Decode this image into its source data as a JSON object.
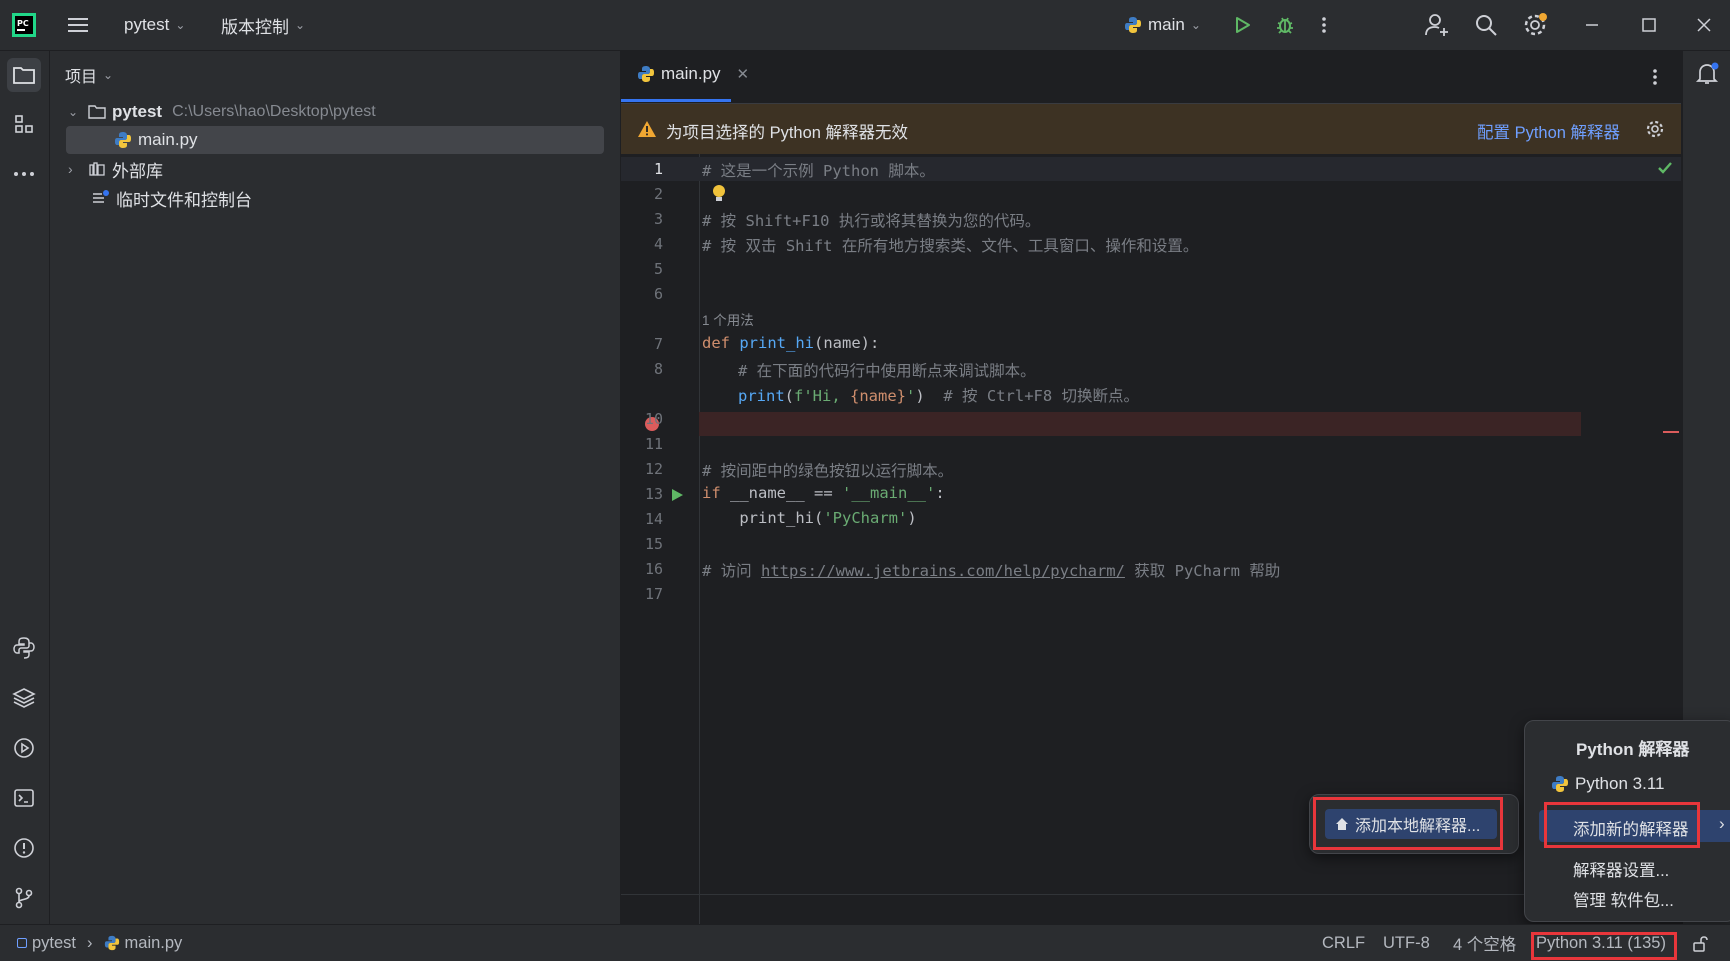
{
  "titlebar": {
    "project_name": "pytest",
    "vcs_label": "版本控制",
    "run_config": "main",
    "icons": [
      "pycharm-logo",
      "hamburger-menu-icon",
      "run-icon",
      "debug-icon",
      "more-vertical-icon",
      "add-user-icon",
      "search-icon",
      "settings-icon",
      "minimize-icon",
      "maximize-icon",
      "close-icon"
    ]
  },
  "project_panel": {
    "header": "项目",
    "tree": {
      "root_name": "pytest",
      "root_path": "C:\\Users\\hao\\Desktop\\pytest",
      "file": "main.py",
      "external_libs": "外部库",
      "scratches": "临时文件和控制台"
    }
  },
  "editor": {
    "tab_label": "main.py",
    "banner_text": "为项目选择的 Python 解释器无效",
    "banner_link": "配置 Python 解释器",
    "usage_hint": "1 个用法",
    "lines": {
      "l1": "# 这是一个示例 Python 脚本。",
      "l3": "# 按 Shift+F10 执行或将其替换为您的代码。",
      "l4": "# 按 双击 Shift 在所有地方搜索类、文件、工具窗口、操作和设置。",
      "l7_kw": "def",
      "l7_fn": "print_hi",
      "l7_rest": "(name):",
      "l8": "# 在下面的代码行中使用断点来调试脚本。",
      "l9_fn": "print",
      "l9_a": "(",
      "l9_str1": "f'Hi, ",
      "l9_b": "{name}",
      "l9_str2": "'",
      "l9_c": ")",
      "l9_cm": "  # 按 Ctrl+F8 切换断点。",
      "l12": "# 按间距中的绿色按钮以运行脚本。",
      "l13_kw": "if",
      "l13_a": " __name__ == ",
      "l13_str": "'__main__'",
      "l13_b": ":",
      "l14_a": "    print_hi(",
      "l14_str": "'PyCharm'",
      "l14_b": ")",
      "l16_a": "# 访问 ",
      "l16_link": "https://www.jetbrains.com/help/pycharm/",
      "l16_b": " 获取 PyCharm 帮助"
    },
    "line_numbers": [
      "1",
      "2",
      "3",
      "4",
      "5",
      "6",
      "7",
      "8",
      "",
      "10",
      "11",
      "12",
      "13",
      "14",
      "15",
      "16",
      "17"
    ]
  },
  "popup": {
    "title": "Python 解释器",
    "interpreter": "Python 3.11",
    "add_new": "添加新的解释器",
    "settings": "解释器设置...",
    "manage": "管理 软件包..."
  },
  "subpopup": {
    "add_local": "添加本地解释器..."
  },
  "statusbar": {
    "breadcrumb_root": "pytest",
    "breadcrumb_file": "main.py",
    "line_sep": "CRLF",
    "encoding": "UTF-8",
    "indent": "4 个空格",
    "interpreter": "Python 3.11 (135)"
  },
  "colors": {
    "accent": "#3574f0",
    "highlight_box": "#e8363b",
    "breakpoint": "#db5c5c",
    "run_green": "#5fb865"
  }
}
